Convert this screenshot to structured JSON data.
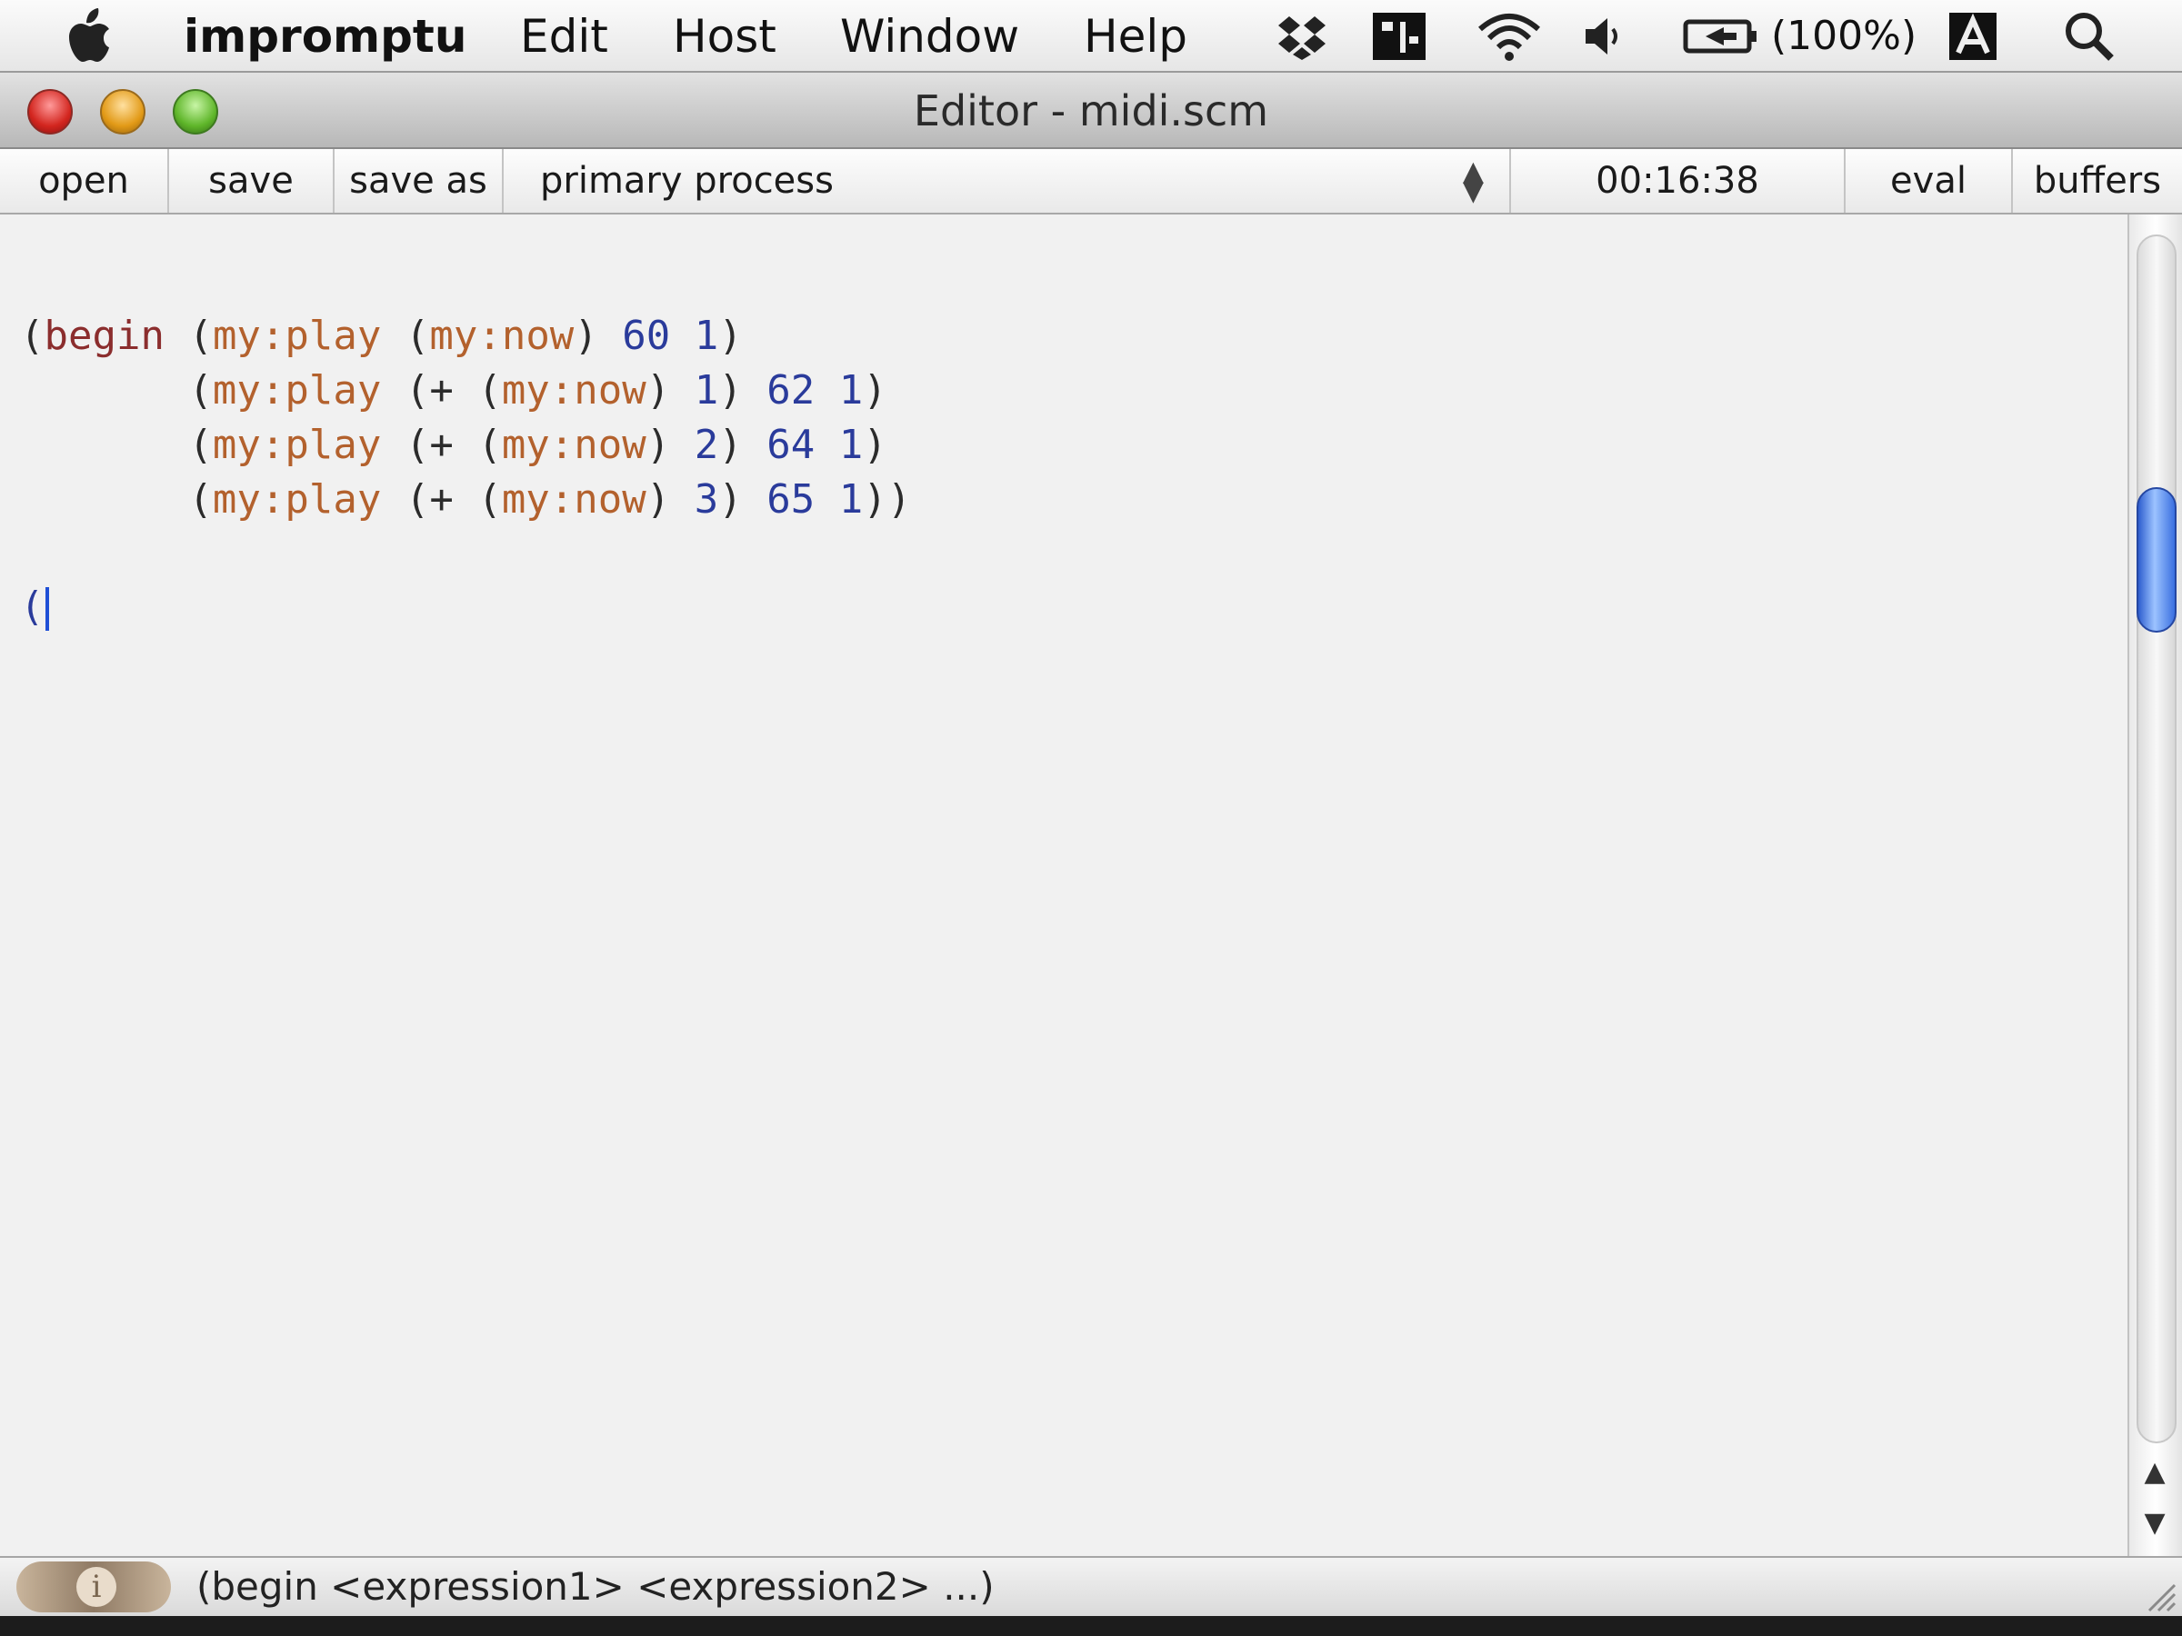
{
  "menubar": {
    "app_name": "impromptu",
    "items": [
      "Edit",
      "Host",
      "Window",
      "Help"
    ],
    "battery_text": "(100%)",
    "icons": [
      "apple-icon",
      "dropbox-icon",
      "calendar-icon",
      "wifi-icon",
      "volume-icon",
      "battery-icon",
      "input-menu-icon",
      "spotlight-icon"
    ]
  },
  "window": {
    "title": "Editor - midi.scm"
  },
  "toolbar": {
    "open_label": "open",
    "save_label": "save",
    "save_as_label": "save as",
    "process_select_value": "primary process",
    "time_display": "00:16:38",
    "eval_label": "eval",
    "buffers_label": "buffers"
  },
  "editor": {
    "lines": [
      "(begin (my:play (my:now) 60 1)",
      "       (my:play (+ (my:now) 1) 62 1)",
      "       (my:play (+ (my:now) 2) 64 1)",
      "       (my:play (+ (my:now) 3) 65 1))"
    ],
    "current_line": "("
  },
  "statusbar": {
    "hint": "(begin <expression1> <expression2> ...)",
    "logo_text": "i"
  },
  "colors": {
    "keyword": "#8b2d2d",
    "function": "#b3612d",
    "number": "#2a3b9b",
    "scroll_thumb": "#3a6fe0"
  }
}
